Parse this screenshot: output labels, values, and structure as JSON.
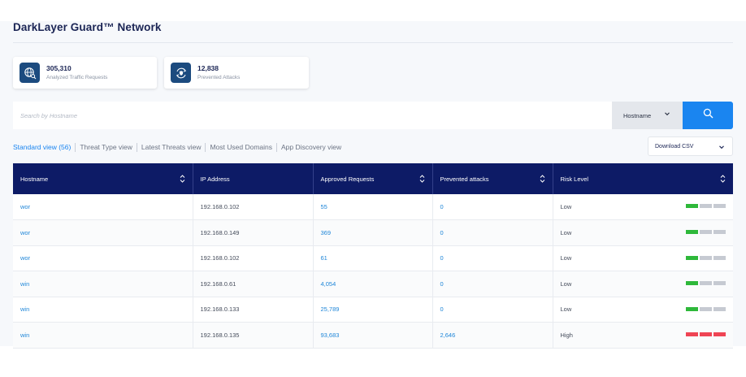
{
  "page": {
    "title": "DarkLayer Guard™ Network"
  },
  "stats": [
    {
      "value": "305,310",
      "label": "Analyzed Traffic Requests",
      "icon": "globe-search-icon"
    },
    {
      "value": "12,838",
      "label": "Prevented Attacks",
      "icon": "shield-refresh-icon"
    }
  ],
  "search": {
    "placeholder": "Search by Hostname",
    "value": "",
    "filter_label": "Hostname",
    "button_icon": "search-icon"
  },
  "tabs": [
    {
      "label": "Standard view (56)",
      "active": true
    },
    {
      "label": "Threat Type view",
      "active": false
    },
    {
      "label": "Latest Threats view",
      "active": false
    },
    {
      "label": "Most Used Domains",
      "active": false
    },
    {
      "label": "App Discovery view",
      "active": false
    }
  ],
  "download": {
    "label": "Download CSV"
  },
  "table": {
    "columns": [
      "Hostname",
      "IP Address",
      "Approved Requests",
      "Prevented attacks",
      "Risk Level"
    ],
    "rows": [
      {
        "hostname": "wor",
        "ip": "192.168.0.102",
        "approved": "55",
        "prevented": "0",
        "risk": "Low"
      },
      {
        "hostname": "wor",
        "ip": "192.168.0.149",
        "approved": "369",
        "prevented": "0",
        "risk": "Low"
      },
      {
        "hostname": "wor",
        "ip": "192.168.0.102",
        "approved": "61",
        "prevented": "0",
        "risk": "Low"
      },
      {
        "hostname": "win",
        "ip": "192.168.0.61",
        "approved": "4,054",
        "prevented": "0",
        "risk": "Low"
      },
      {
        "hostname": "win",
        "ip": "192.168.0.133",
        "approved": "25,789",
        "prevented": "0",
        "risk": "Low"
      },
      {
        "hostname": "win",
        "ip": "192.168.0.135",
        "approved": "93,683",
        "prevented": "2,646",
        "risk": "High"
      }
    ]
  },
  "colors": {
    "accent": "#1a85f0",
    "header": "#0d1b66",
    "risk_low": "#2eb83a",
    "risk_high": "#ef4454",
    "risk_empty": "#c6cad2"
  }
}
